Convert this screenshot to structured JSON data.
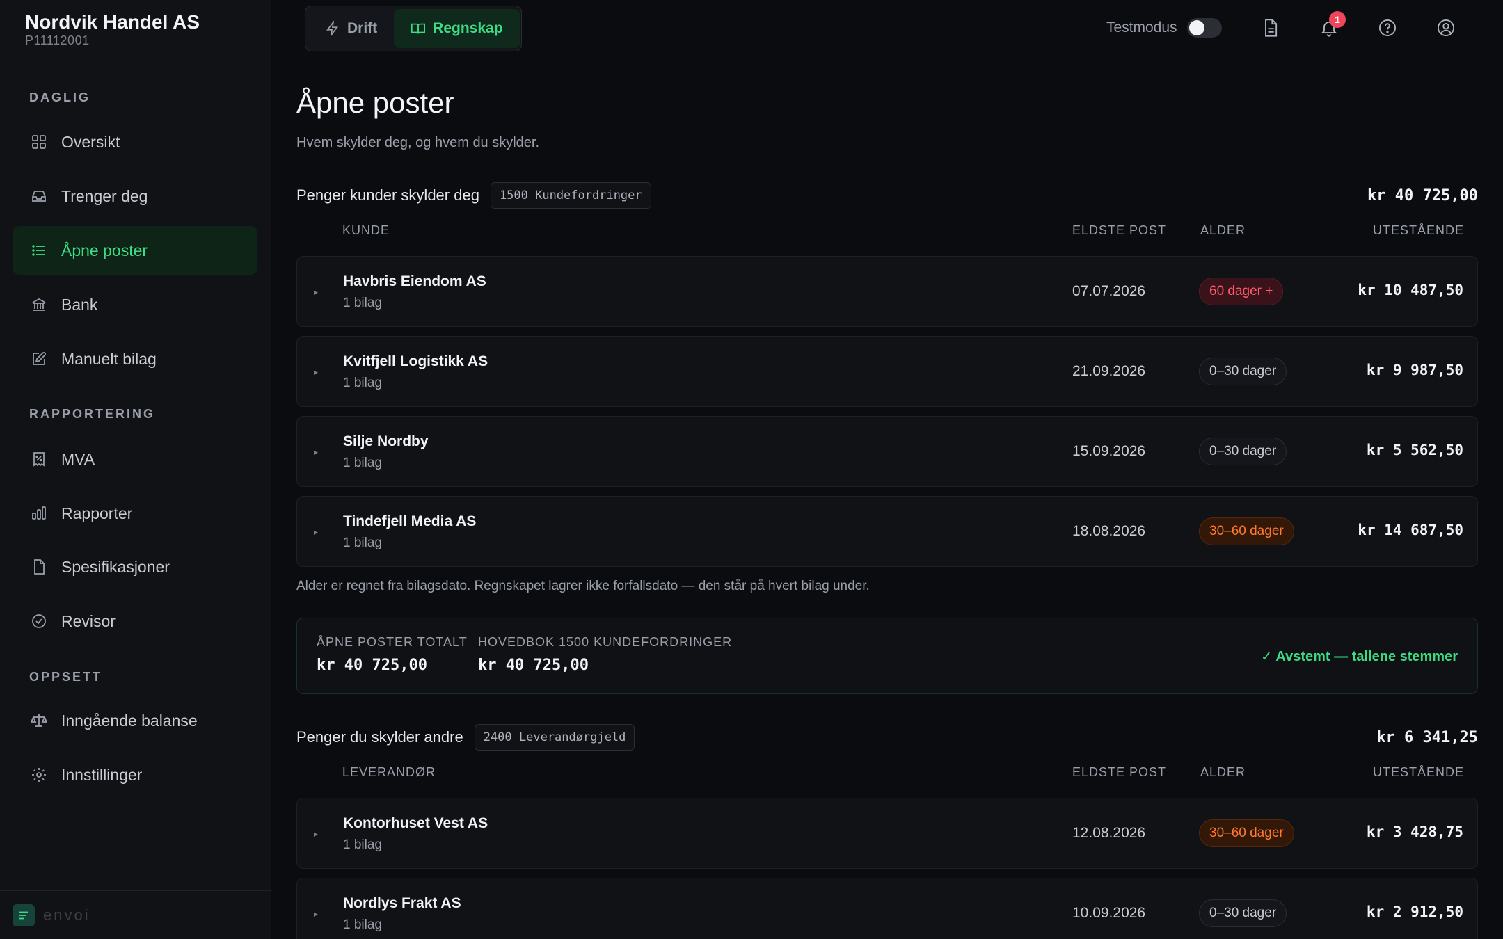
{
  "sidebar": {
    "org_name": "Nordvik Handel AS",
    "org_id": "P11112001",
    "sections": {
      "daglig": "DAGLIG",
      "rapportering": "RAPPORTERING",
      "oppsett": "OPPSETT"
    },
    "items": [
      {
        "label": "Oversikt",
        "icon": "grid-icon"
      },
      {
        "label": "Trenger deg",
        "icon": "inbox-icon"
      },
      {
        "label": "Åpne poster",
        "icon": "list-icon",
        "active": true
      },
      {
        "label": "Bank",
        "icon": "bank-icon"
      },
      {
        "label": "Manuelt bilag",
        "icon": "edit-icon"
      },
      {
        "label": "MVA",
        "icon": "receipt-percent-icon"
      },
      {
        "label": "Rapporter",
        "icon": "bar-chart-icon"
      },
      {
        "label": "Spesifikasjoner",
        "icon": "document-icon"
      },
      {
        "label": "Revisor",
        "icon": "check-circle-icon"
      },
      {
        "label": "Inngående balanse",
        "icon": "scale-icon"
      },
      {
        "label": "Innstillinger",
        "icon": "gear-icon"
      }
    ],
    "brand": "envoi"
  },
  "topbar": {
    "modes": [
      {
        "label": "Drift",
        "icon": "lightning-icon"
      },
      {
        "label": "Regnskap",
        "icon": "book-icon",
        "active": true
      }
    ],
    "testmode_label": "Testmodus",
    "testmode_on": false,
    "notification_count": "1"
  },
  "page": {
    "title": "Åpne poster",
    "subtitle": "Hvem skylder deg, og hvem du skylder."
  },
  "receivables": {
    "title": "Penger kunder skylder deg",
    "account": "1500 Kundefordringer",
    "total": "kr 40 725,00",
    "columns": {
      "party": "KUNDE",
      "oldest": "ELDSTE POST",
      "age": "ALDER",
      "outstanding": "UTESTÅENDE"
    },
    "rows": [
      {
        "name": "Havbris Eiendom AS",
        "sub": "1 bilag",
        "date": "07.07.2026",
        "age": "60 dager +",
        "age_level": "red",
        "amount": "kr 10 487,50"
      },
      {
        "name": "Kvitfjell Logistikk AS",
        "sub": "1 bilag",
        "date": "21.09.2026",
        "age": "0–30 dager",
        "age_level": "neutral",
        "amount": "kr 9 987,50"
      },
      {
        "name": "Silje Nordby",
        "sub": "1 bilag",
        "date": "15.09.2026",
        "age": "0–30 dager",
        "age_level": "neutral",
        "amount": "kr 5 562,50"
      },
      {
        "name": "Tindefjell Media AS",
        "sub": "1 bilag",
        "date": "18.08.2026",
        "age": "30–60 dager",
        "age_level": "orange",
        "amount": "kr 14 687,50"
      }
    ],
    "note": "Alder er regnet fra bilagsdato. Regnskapet lagrer ikke forfallsdato — den står på hvert bilag under."
  },
  "reconciliation": {
    "open_label": "ÅPNE POSTER TOTALT",
    "open_value": "kr 40 725,00",
    "ledger_label": "HOVEDBOK 1500 KUNDEFORDRINGER",
    "ledger_value": "kr 40 725,00",
    "status": "✓ Avstemt — tallene stemmer"
  },
  "payables": {
    "title": "Penger du skylder andre",
    "account": "2400 Leverandørgjeld",
    "total": "kr 6 341,25",
    "columns": {
      "party": "LEVERANDØR",
      "oldest": "ELDSTE POST",
      "age": "ALDER",
      "outstanding": "UTESTÅENDE"
    },
    "rows": [
      {
        "name": "Kontorhuset Vest AS",
        "sub": "1 bilag",
        "date": "12.08.2026",
        "age": "30–60 dager",
        "age_level": "orange",
        "amount": "kr 3 428,75"
      },
      {
        "name": "Nordlys Frakt AS",
        "sub": "1 bilag",
        "date": "10.09.2026",
        "age": "0–30 dager",
        "age_level": "neutral",
        "amount": "kr 2 912,50"
      }
    ]
  },
  "colors": {
    "accent": "#3ddc84",
    "age_red": "#ff5c6c",
    "age_orange": "#ff7a2e",
    "badge": "#f0455a"
  }
}
